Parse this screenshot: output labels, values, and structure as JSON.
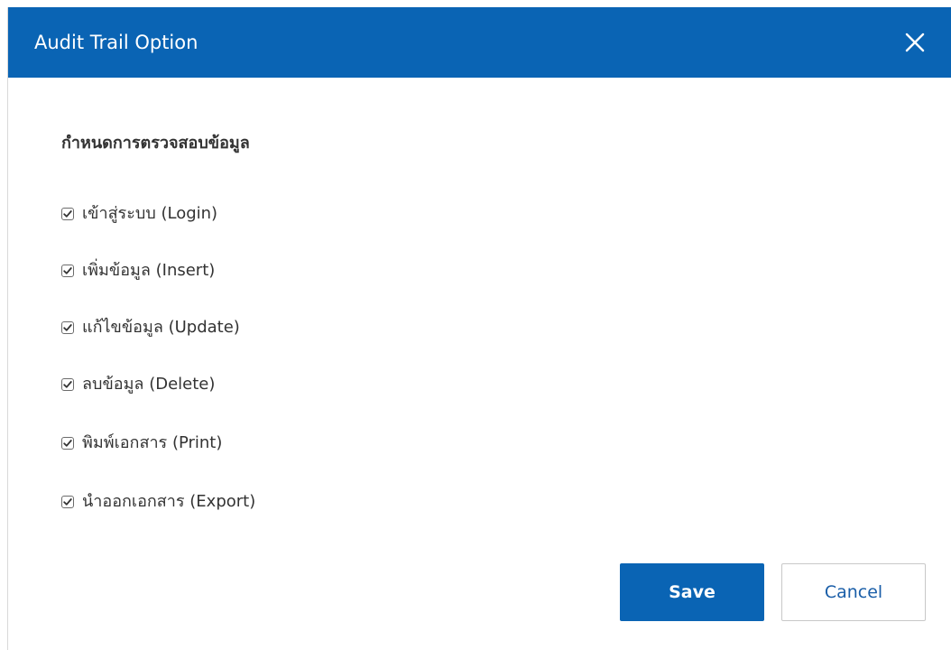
{
  "dialog": {
    "title": "Audit Trail Option",
    "close_icon": "close-icon",
    "colors": {
      "header": "#0a64b4",
      "save_button": "#0a64b4"
    }
  },
  "section": {
    "heading": "กำหนดการตรวจสอบข้อมูล"
  },
  "options": [
    {
      "label": "เข้าสู่ระบบ (Login)",
      "checked": true
    },
    {
      "label": "เพิ่มข้อมูล (Insert)",
      "checked": true
    },
    {
      "label": "แก้ไขข้อมูล (Update)",
      "checked": true
    },
    {
      "label": "ลบข้อมูล (Delete)",
      "checked": true
    },
    {
      "label": "พิมพ์เอกสาร (Print)",
      "checked": true
    },
    {
      "label": "นำออกเอกสาร (Export)",
      "checked": true
    }
  ],
  "buttons": {
    "save_label": "Save",
    "cancel_label": "Cancel"
  }
}
